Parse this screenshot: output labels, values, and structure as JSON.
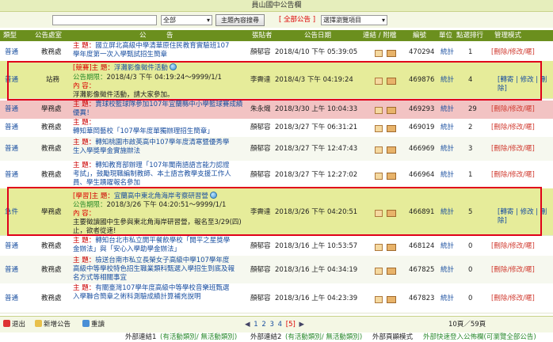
{
  "title": "員山國中公告欄",
  "search": {
    "text_value": "",
    "dept_select": "全部",
    "button_label": "主題內容搜尋",
    "all_link": "[ 全部公告 ]",
    "category_select": "選擇瀏覽項目"
  },
  "columns": [
    "類型",
    "公告處室",
    "公　　　告",
    "張貼者",
    "公告日期",
    "連結 / 附檔",
    "編號",
    "單位",
    "點選排行",
    "管理模式"
  ],
  "rows": [
    {
      "type": "普通",
      "dept": "教務處",
      "subject_label": "主 題：",
      "subject": "國立屏北高級中學清華原住民教育實驗班107學年度第一次入學甄試招生簡章",
      "poster": "顏郁容",
      "date": "2018/4/10 下午 05:39:05",
      "id": "470294",
      "unit": "統計",
      "hits": "1",
      "mgmt": "[刪除/修改/暱]"
    },
    {
      "type": "普通",
      "dept": "站務",
      "tag": "[競賽]",
      "subject_label": "主 題：",
      "subject": "浮灘影像徵件活動",
      "period_label": "公告期限：",
      "period": "2018/4/3 下午 04:19:24～9999/1/1",
      "content_label": "內 容：",
      "content": "浮灘影像徵件活動，請大家參加。",
      "poster": "李霽達",
      "date": "2018/4/3 下午 04:19:24",
      "id": "469876",
      "unit": "統計",
      "hits": "4",
      "mgmt": "[轉寄 | 修改 | 刪除]"
    },
    {
      "type": "普通",
      "dept": "學務處",
      "subject_label": "主 題：",
      "subject": "賣球校籃球隊參加107年宜蘭縣中小學籃球賽成績優異！",
      "poster": "朱永熾",
      "date": "2018/3/30 上午 10:04:33",
      "id": "469293",
      "unit": "統計",
      "hits": "29",
      "mgmt": "[刪除/修改/暱]"
    },
    {
      "type": "普通",
      "dept": "教務處",
      "subject_label": "主 題：",
      "subject": "轉知華岡藝校「107學年度單獨辦理招生簡章」",
      "poster": "顏郁容",
      "date": "2018/3/27 下午 06:31:21",
      "id": "469019",
      "unit": "統計",
      "hits": "2",
      "mgmt": "[刪除/修改/暱]"
    },
    {
      "type": "普通",
      "dept": "教務處",
      "subject_label": "主 題：",
      "subject": "轉知桃園市啟英高中107學年度清寒暨優秀學生入學獎學金實施辦法",
      "poster": "顏郁容",
      "date": "2018/3/27 下午 12:47:43",
      "id": "466969",
      "unit": "統計",
      "hits": "3",
      "mgmt": "[刪除/修改/暱]"
    },
    {
      "type": "普通",
      "dept": "教務處",
      "subject_label": "主 題：",
      "subject": "轉知教育部辦理「107年閩南語語言能力認證考試」，鼓勵現職編制教師、本土語言教學支援工作人員、學生踴躍報名參加",
      "poster": "顏郁容",
      "date": "2018/3/27 下午 12:27:02",
      "id": "466964",
      "unit": "統計",
      "hits": "1",
      "mgmt": "[刪除/修改/暱]"
    },
    {
      "type": "急件",
      "dept": "學務處",
      "tag": "[學習]",
      "subject_label": "主 題：",
      "subject": "宜蘭高中東北角海岸考察研習營",
      "period_label": "公告期限：",
      "period": "2018/3/26 下午 04:20:51～9999/1/1",
      "content_label": "內 容：",
      "content": "主要徵讀國中生參與東北角海岸研習營，報名至3/29(四)止，欲者從速!",
      "poster": "李霽達",
      "date": "2018/3/26 下午 04:20:51",
      "id": "466891",
      "unit": "統計",
      "hits": "5",
      "mgmt": "[轉寄 | 修改 | 刪除]"
    },
    {
      "type": "普通",
      "dept": "教務處",
      "subject_label": "主 題：",
      "subject": "轉知台北市私立開平餐飲學校「開平之星獎學金辦法」與「安心入學助學金辦法」",
      "poster": "顏郁容",
      "date": "2018/3/16 上午 10:53:57",
      "id": "468124",
      "unit": "統計",
      "hits": "0",
      "mgmt": "[刪除/修改/暱]"
    },
    {
      "type": "普通",
      "dept": "教務處",
      "subject_label": "主 題：",
      "subject": "檢送台南市私立長榮女子高級中學107學年度高級中等學校特色招生職業類科甄選入學招生到底及報名方式等相關事宜",
      "poster": "顏郁容",
      "date": "2018/3/16 上午 04:34:19",
      "id": "467825",
      "unit": "統計",
      "hits": "0",
      "mgmt": "[刪除/修改/暱]"
    },
    {
      "type": "普通",
      "dept": "教務處",
      "subject_label": "主 題：",
      "subject": "有關臺灣107學年度高級中等學校音樂班甄選入學聯合簡章之術科測驗成績計算補充說明",
      "poster": "顏郁容",
      "date": "2018/3/16 上午 04:23:39",
      "id": "467823",
      "unit": "統計",
      "hits": "0",
      "mgmt": "[刪除/修改/暱]"
    }
  ],
  "toolbar": {
    "exit": "退出",
    "add": "新增公告",
    "reorder": "重讀"
  },
  "pager": {
    "prev": "◀",
    "pages": [
      "1",
      "2",
      "3",
      "4"
    ],
    "current": "[5]",
    "next": "▶",
    "status": "10頁／59頁"
  },
  "footer_links": {
    "ext1": "外部連結1",
    "ext1_sub": "(有活動類別/ 無活動類別)",
    "ext2": "外部連結2",
    "ext2_sub": "(有活動類別/ 無活動類別)",
    "ext_page": "外部頁顯模式",
    "quick": "外部快速登入公佈欄(可瀏覽全部公告)"
  }
}
